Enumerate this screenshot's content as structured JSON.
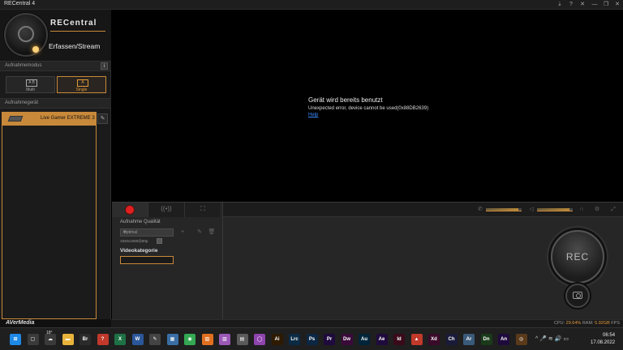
{
  "window": {
    "title": "RECentral 4",
    "controls": [
      "⇣",
      "?",
      "✕",
      "—",
      "❐",
      "✕"
    ]
  },
  "sidebar": {
    "brand": "RECentral",
    "mode_title": "Erfassen/Stream",
    "section_mode": "Aufnahmemodus",
    "info_label": "i",
    "modes": [
      {
        "label": "Multi",
        "icon": "A B"
      },
      {
        "label": "Single",
        "icon": "A"
      }
    ],
    "section_device": "Aufnahmegerät",
    "device_name": "Live Gamer EXTREME 3",
    "footer_brand": "AVerMedia"
  },
  "preview": {
    "error_title": "Gerät wird bereits benutzt",
    "error_message": "Unexpected error, device cannot be used(0x88DB2639)",
    "help_link": "Help"
  },
  "control": {
    "tabs": [
      {
        "name": "record"
      },
      {
        "name": "stream",
        "glyph": "((•))"
      },
      {
        "name": "network",
        "glyph": "⛶"
      }
    ],
    "quality_label": "Aufnahme Qualität",
    "quality_value": "Optimal",
    "resolution": "1920x1080@60p",
    "category_label": "Videokategorie",
    "category_value": "",
    "rec_label": "REC",
    "meter_levels": [
      0.9,
      0.9
    ]
  },
  "status": {
    "cpu_label": "CPU:",
    "cpu_value": "29.64%",
    "ram_label": "RAM:",
    "ram_value": "5.92GB",
    "fps_label": "FPS"
  },
  "taskbar": {
    "weather": "18°",
    "apps": [
      {
        "label": "⊞",
        "color": "#1e88e5"
      },
      {
        "label": "▢",
        "color": "#3a3a3a"
      },
      {
        "label": "☁",
        "color": "#3a3a3a"
      },
      {
        "label": "▬",
        "color": "#e8b33a"
      },
      {
        "label": "Br",
        "color": "#2b2b2b"
      },
      {
        "label": "?",
        "color": "#c0392b"
      },
      {
        "label": "X",
        "color": "#1e7145"
      },
      {
        "label": "W",
        "color": "#2b579a"
      },
      {
        "label": "✎",
        "color": "#444"
      },
      {
        "label": "▦",
        "color": "#3a6ea5"
      },
      {
        "label": "◉",
        "color": "#34a853"
      },
      {
        "label": "▨",
        "color": "#e07020"
      },
      {
        "label": "▨",
        "color": "#9b59b6"
      },
      {
        "label": "▤",
        "color": "#5a5a5a"
      },
      {
        "label": "◯",
        "color": "#8e44ad"
      },
      {
        "label": "Ai",
        "color": "#2d1a00"
      },
      {
        "label": "Lrc",
        "color": "#0b2a44"
      },
      {
        "label": "Ps",
        "color": "#0b2744"
      },
      {
        "label": "Pr",
        "color": "#1f0a3d"
      },
      {
        "label": "Dw",
        "color": "#3a0a3a"
      },
      {
        "label": "Au",
        "color": "#00253a"
      },
      {
        "label": "Ae",
        "color": "#1f0a3d"
      },
      {
        "label": "Id",
        "color": "#3a0a1a"
      },
      {
        "label": "▲",
        "color": "#c0392b"
      },
      {
        "label": "Xd",
        "color": "#3a0a2a"
      },
      {
        "label": "Ch",
        "color": "#1a1a3a"
      },
      {
        "label": "Ar",
        "color": "#3a5a7a"
      },
      {
        "label": "Dn",
        "color": "#1a3a1a"
      },
      {
        "label": "An",
        "color": "#1f0a3d"
      },
      {
        "label": "◎",
        "color": "#5a3a1a"
      }
    ],
    "tray": "^  🎤  ≋  🔊  ▭",
    "time": "06:54",
    "date": "17.08.2022"
  }
}
